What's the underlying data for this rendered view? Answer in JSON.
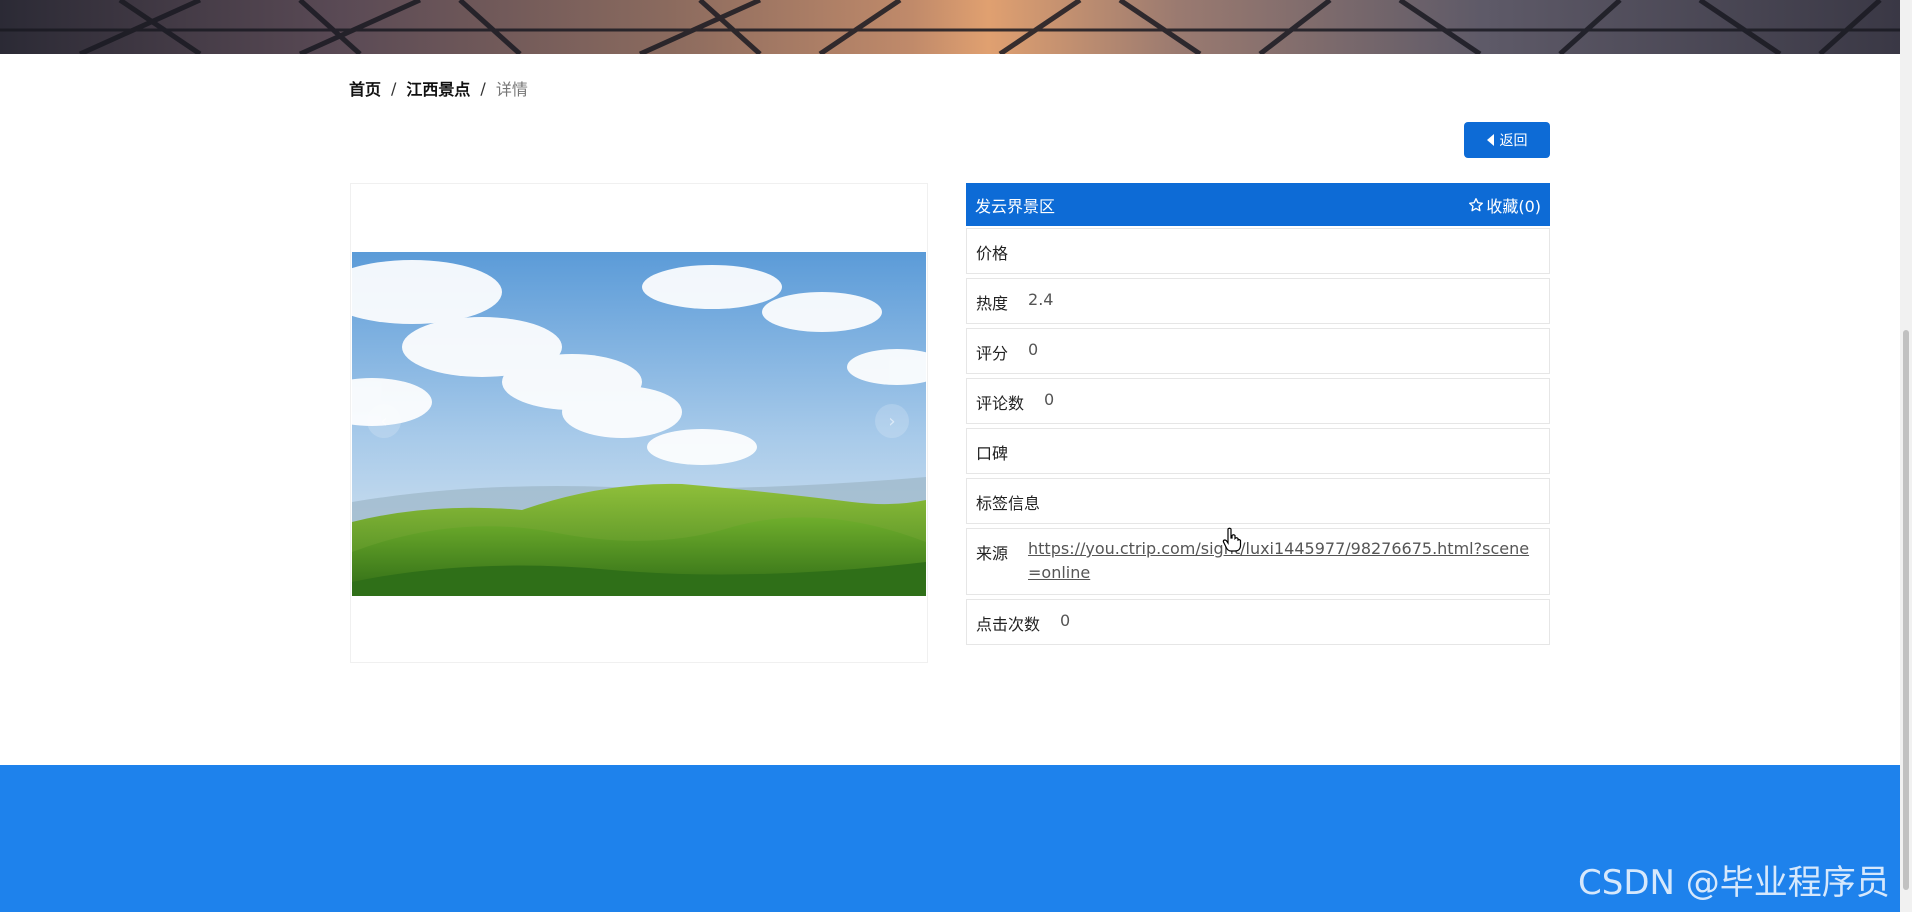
{
  "breadcrumb": {
    "home": "首页",
    "category": "江西景点",
    "current": "详情",
    "separator": "/"
  },
  "back_button": {
    "label": "返回",
    "icon": "caret-left-icon"
  },
  "detail": {
    "title": "发云界景区",
    "favorite_label": "收藏(0)",
    "favorite_icon": "star-outline-icon",
    "rows": [
      {
        "label": "价格",
        "value": ""
      },
      {
        "label": "热度",
        "value": "2.4"
      },
      {
        "label": "评分",
        "value": "0"
      },
      {
        "label": "评论数",
        "value": "0"
      },
      {
        "label": "口碑",
        "value": ""
      },
      {
        "label": "标签信息",
        "value": ""
      },
      {
        "label": "来源",
        "value": "https://you.ctrip.com/sight/luxi1445977/98276675.html?scene=online"
      },
      {
        "label": "点击次数",
        "value": "0"
      }
    ]
  },
  "carousel": {
    "prev": "‹",
    "next": "›"
  },
  "watermark": "CSDN @毕业程序员",
  "colors": {
    "primary": "#0d6bd6",
    "footer": "#1e82ec"
  }
}
